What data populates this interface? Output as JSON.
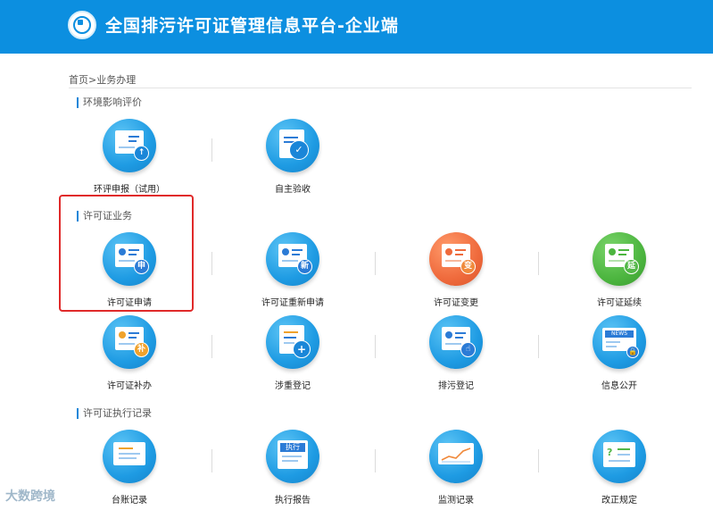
{
  "header": {
    "title": "全国排污许可证管理信息平台-企业端"
  },
  "breadcrumb": "首页>业务办理",
  "sections": [
    {
      "title": "环境影响评价",
      "items": [
        {
          "label": "环评申报（试用）",
          "icon": "upload-doc-icon"
        },
        {
          "label": "自主验收",
          "icon": "checklist-icon"
        }
      ]
    },
    {
      "title": "许可证业务",
      "items": [
        {
          "label": "许可证申请",
          "icon": "license-apply-icon",
          "badge": "申"
        },
        {
          "label": "许可证重新申请",
          "icon": "license-reapply-icon",
          "badge": "新"
        },
        {
          "label": "许可证变更",
          "icon": "license-change-icon",
          "badge": "变"
        },
        {
          "label": "许可证延续",
          "icon": "license-extend-icon",
          "badge": "延"
        },
        {
          "label": "许可证补办",
          "icon": "license-reissue-icon",
          "badge": "补"
        },
        {
          "label": "涉重登记",
          "icon": "heavy-metal-register-icon"
        },
        {
          "label": "排污登记",
          "icon": "discharge-register-icon"
        },
        {
          "label": "信息公开",
          "icon": "news-disclosure-icon",
          "text": "NEWS"
        }
      ]
    },
    {
      "title": "许可证执行记录",
      "items": [
        {
          "label": "台账记录",
          "icon": "ledger-icon"
        },
        {
          "label": "执行报告",
          "icon": "execution-report-icon",
          "text": "执行"
        },
        {
          "label": "监测记录",
          "icon": "monitoring-chart-icon"
        },
        {
          "label": "改正规定",
          "icon": "rectification-icon",
          "text": "?"
        }
      ]
    }
  ],
  "watermark": "大数跨境",
  "colors": {
    "header": "#0c8fe0",
    "highlight": "#e02a2a",
    "badge_green": "#53b848",
    "badge_orange": "#f08a3c",
    "badge_blue": "#2b7bd6"
  }
}
